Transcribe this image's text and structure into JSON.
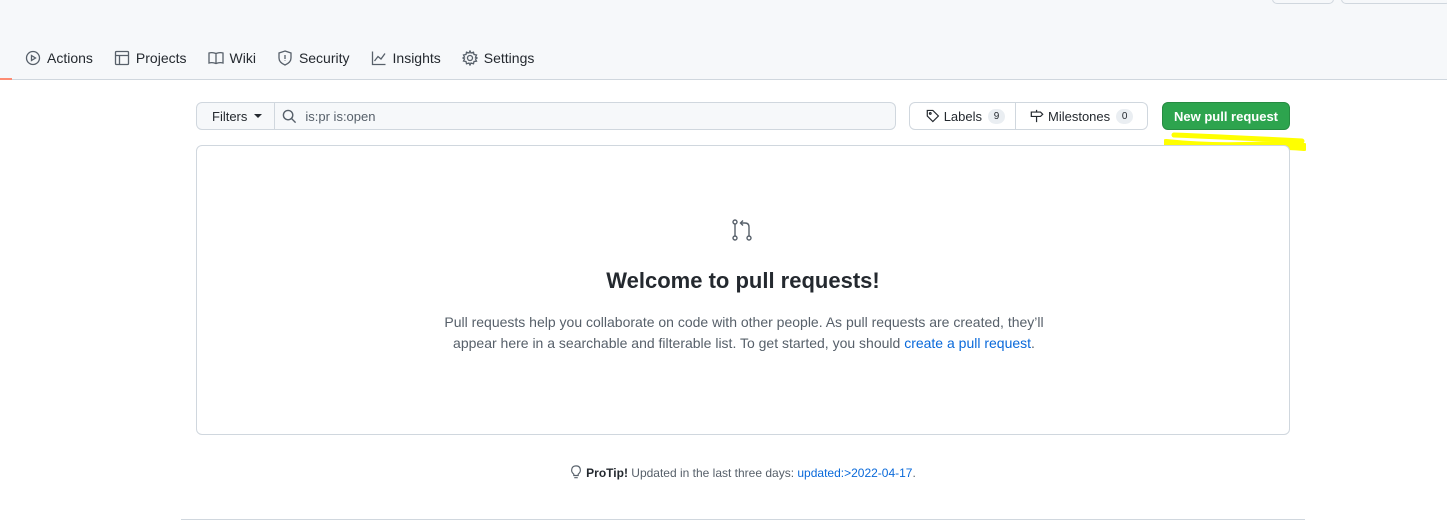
{
  "tabs": [
    {
      "label": "Actions",
      "icon": "play-icon"
    },
    {
      "label": "Projects",
      "icon": "table-icon"
    },
    {
      "label": "Wiki",
      "icon": "book-icon"
    },
    {
      "label": "Security",
      "icon": "shield-icon"
    },
    {
      "label": "Insights",
      "icon": "graph-icon"
    },
    {
      "label": "Settings",
      "icon": "gear-icon"
    }
  ],
  "subnav": {
    "filters_label": "Filters",
    "search_value": "is:pr is:open",
    "labels_label": "Labels",
    "labels_count": "9",
    "milestones_label": "Milestones",
    "milestones_count": "0",
    "new_pr_label": "New pull request"
  },
  "blankslate": {
    "title": "Welcome to pull requests!",
    "text_1": "Pull requests help you collaborate on code with other people. As pull requests are created, they’ll appear here in a searchable and filterable list. To get started, you should ",
    "link": "create a pull request",
    "text_2": "."
  },
  "protip": {
    "label": "ProTip!",
    "text": " Updated in the last three days: ",
    "link": "updated:>2022-04-17",
    "end": "."
  },
  "colors": {
    "primary_green": "#2da44e",
    "link_blue": "#0969da",
    "highlight_yellow": "#ffff00"
  }
}
